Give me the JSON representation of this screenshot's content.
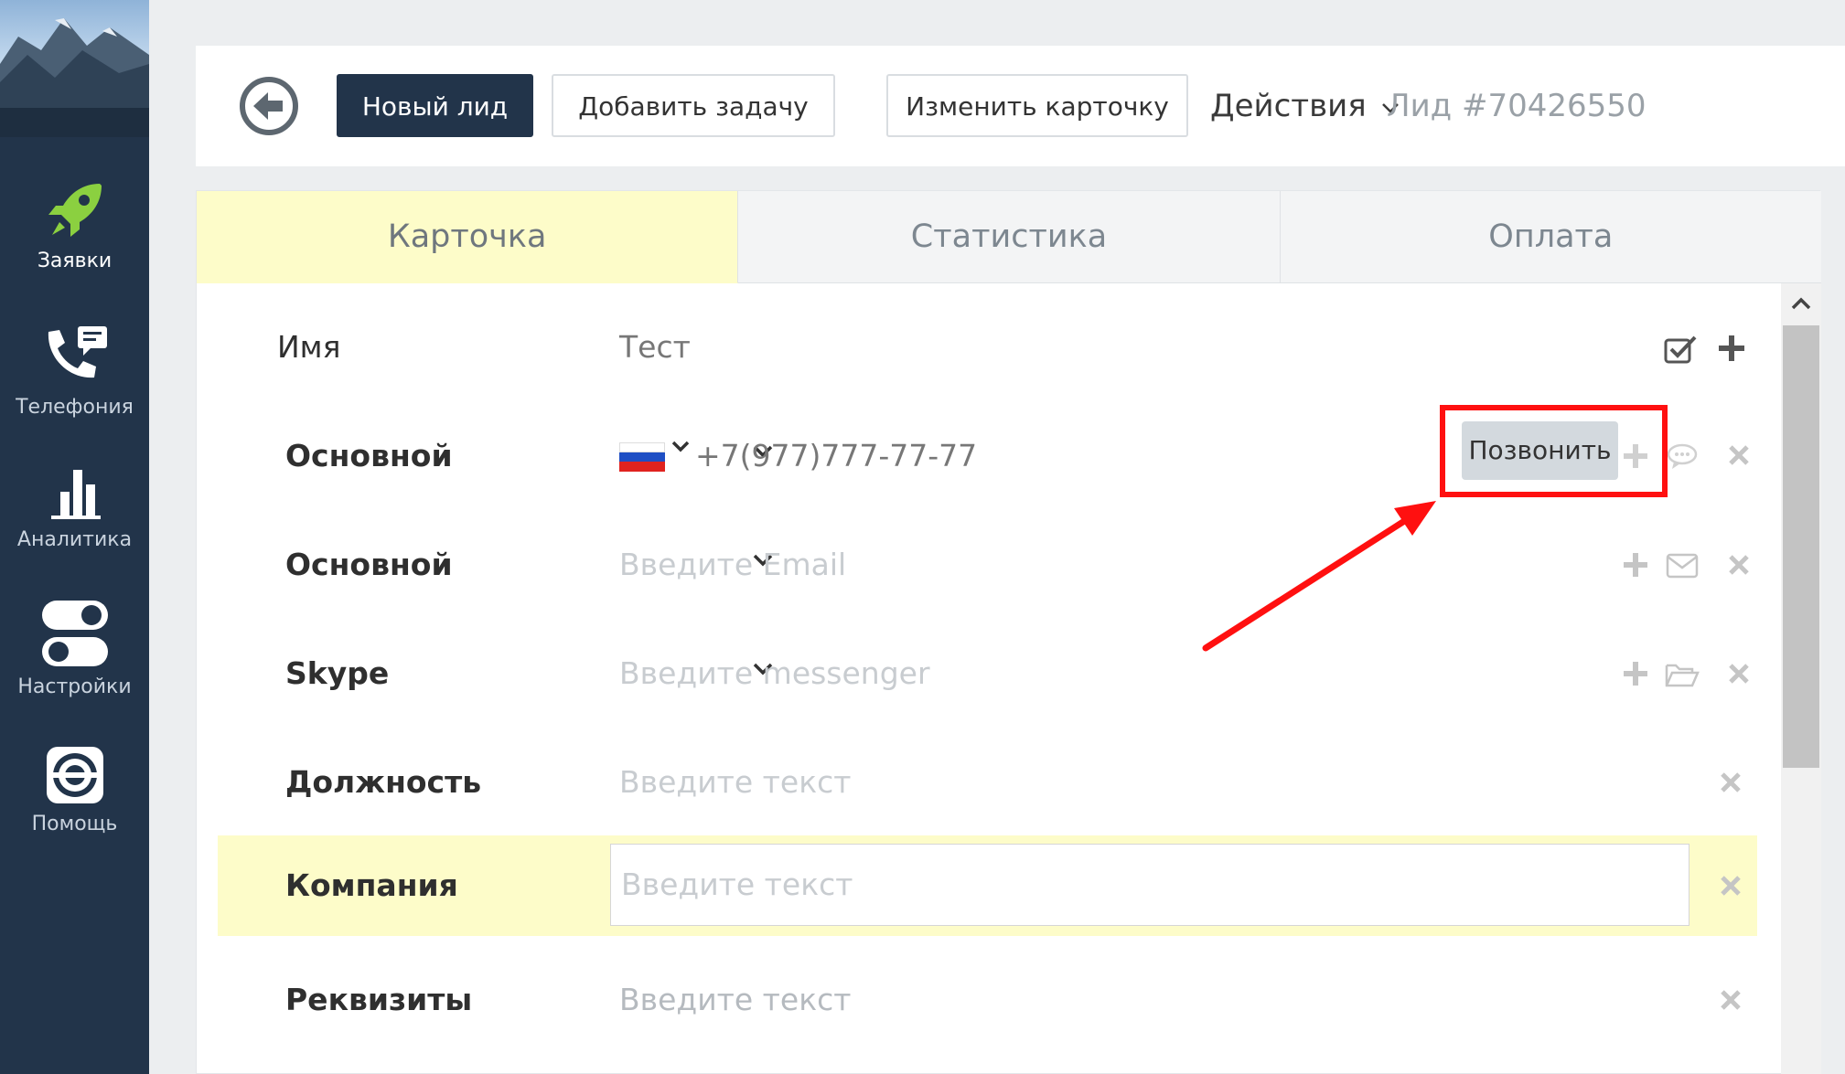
{
  "sidebar": {
    "items": [
      {
        "label": "Заявки",
        "icon": "rocket-icon",
        "active": true
      },
      {
        "label": "Телефония",
        "icon": "phone-chat-icon",
        "active": false
      },
      {
        "label": "Аналитика",
        "icon": "bar-chart-icon",
        "active": false
      },
      {
        "label": "Настройки",
        "icon": "toggle-icon",
        "active": false
      },
      {
        "label": "Помощь",
        "icon": "lifebuoy-icon",
        "active": false
      }
    ]
  },
  "toolbar": {
    "back_icon": "back-arrow-icon",
    "new_lead_label": "Новый лид",
    "add_task_label": "Добавить задачу",
    "edit_card_label": "Изменить карточку",
    "actions_label": "Действия",
    "lead_id": "Лид #70426550"
  },
  "tabs": [
    {
      "label": "Карточка",
      "active": true
    },
    {
      "label": "Статистика",
      "active": false
    },
    {
      "label": "Оплата",
      "active": false
    }
  ],
  "card": {
    "name": {
      "label": "Имя",
      "value": "Тест"
    },
    "phone": {
      "label": "Основной",
      "country": "RU",
      "value": "+7(977)777-77-77",
      "call_label": "Позвонить"
    },
    "email": {
      "label": "Основной",
      "placeholder": "Введите Email"
    },
    "messenger": {
      "label": "Skype",
      "placeholder": "Введите messenger"
    },
    "position": {
      "label": "Должность",
      "placeholder": "Введите текст"
    },
    "company": {
      "label": "Компания",
      "placeholder": "Введите текст"
    },
    "requisites": {
      "label": "Реквизиты",
      "placeholder": "Введите текст"
    }
  },
  "colors": {
    "sidebar_bg": "#22344a",
    "primary_button": "#22344a",
    "active_tab": "#fdfcc9",
    "annotation_red": "#ff1010"
  }
}
